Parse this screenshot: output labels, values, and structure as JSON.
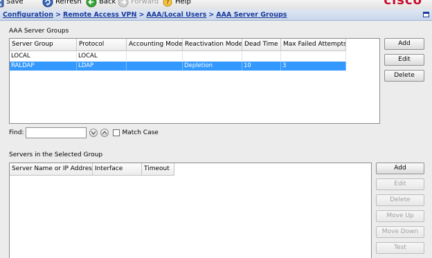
{
  "toolbar": {
    "items": [
      {
        "label": "Save",
        "icon": "save-icon",
        "enabled": true
      },
      {
        "label": "Refresh",
        "icon": "refresh-icon",
        "enabled": true
      },
      {
        "label": "Back",
        "icon": "back-icon",
        "enabled": true
      },
      {
        "label": "Forward",
        "icon": "forward-icon",
        "enabled": false
      },
      {
        "label": "Help",
        "icon": "help-icon",
        "enabled": true
      }
    ],
    "brand": "cisco"
  },
  "breadcrumb": {
    "items": [
      "Configuration",
      "Remote Access VPN",
      "AAA/Local Users",
      "AAA Server Groups"
    ],
    "separator": ">"
  },
  "server_groups": {
    "title": "AAA Server Groups",
    "columns": [
      "Server Group",
      "Protocol",
      "Accounting Mode",
      "Reactivation Mode",
      "Dead Time",
      "Max Failed Attempts"
    ],
    "rows": [
      {
        "cells": [
          "LOCAL",
          "LOCAL",
          "",
          "",
          "",
          ""
        ],
        "selected": false
      },
      {
        "cells": [
          "RALDAP",
          "LDAP",
          "",
          "Depletion",
          "10",
          "3"
        ],
        "selected": true
      }
    ],
    "buttons": {
      "add": "Add",
      "edit": "Edit",
      "delete": "Delete"
    }
  },
  "find": {
    "label": "Find:",
    "value": "",
    "match_case_label": "Match Case",
    "match_case_checked": false
  },
  "servers": {
    "title": "Servers in the Selected Group",
    "columns": [
      "Server Name or IP Address",
      "Interface",
      "Timeout"
    ],
    "rows": [],
    "buttons": {
      "add": "Add",
      "edit": "Edit",
      "delete": "Delete",
      "move_up": "Move Up",
      "move_down": "Move Down",
      "test": "Test"
    }
  },
  "colors": {
    "selection": "#3399ff",
    "link": "#1a3a9c",
    "brand": "#c8102e",
    "crumb_bar": "#c9d6ea"
  }
}
